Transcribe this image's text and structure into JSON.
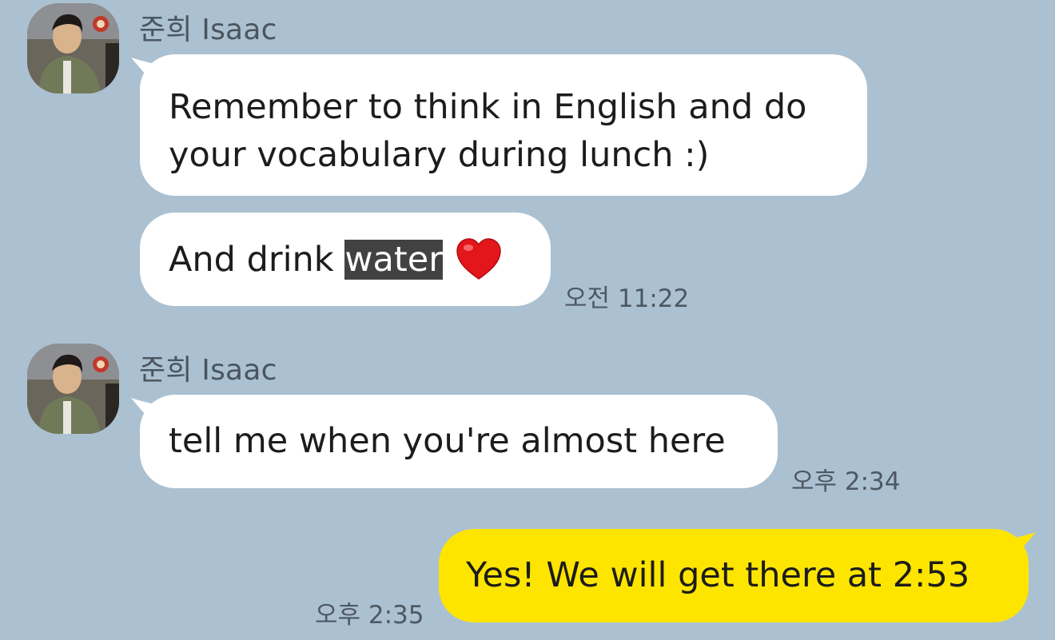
{
  "messages": [
    {
      "sender": "준희 Isaac",
      "lines": [
        "Remember to think in English and do",
        "your vocabulary during lunch :)"
      ]
    },
    {
      "text_before": "And drink ",
      "text_highlighted": "water",
      "emoji": "red-heart-icon",
      "time": "오전 11:22"
    },
    {
      "sender": "준희 Isaac",
      "text": "tell me when you're almost here",
      "time": "오후 2:34"
    },
    {
      "text": "Yes! We will get there at 2:53",
      "time": "오후 2:35",
      "outgoing": true
    }
  ],
  "colors": {
    "background": "#abc1d1",
    "incoming_bubble": "#ffffff",
    "outgoing_bubble": "#fee500",
    "highlight": "#424242"
  }
}
